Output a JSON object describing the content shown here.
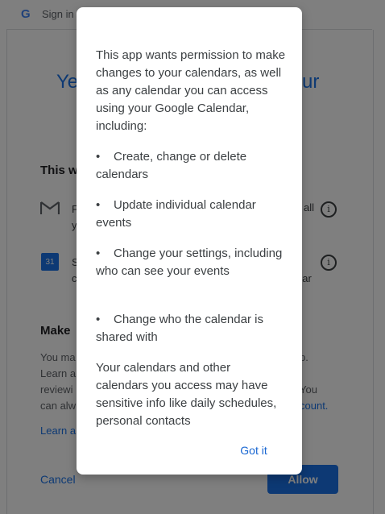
{
  "background": {
    "topbar": {
      "logo": "G",
      "title": "Sign in"
    },
    "title_left": "Ye",
    "title_right": "ur",
    "section_heading": "This w",
    "rows": [
      {
        "icon": "gmail-icon",
        "left": "F\ny",
        "right": "all"
      },
      {
        "icon": "calendar-icon",
        "left": "S\nc",
        "right": "e\ndar",
        "icon_text": "31"
      }
    ],
    "make_heading": "Make",
    "paragraph_left": "You ma\nLearn a\nreviewi\ncan alw",
    "paragraph_right_lines": [
      "p.",
      "",
      "You",
      "count."
    ],
    "learn_link": "Learn a",
    "cancel_label": "Cancel",
    "allow_label": "Allow"
  },
  "dialog": {
    "intro": "This app wants permission to make changes to your calendars, as well as any calendar you can access using your Google Calendar, including:",
    "bullets": [
      "Create, change or delete calendars",
      "Update individual calendar events",
      "Change your settings, including who can see your events",
      "Change who the calendar is shared with"
    ],
    "outro": "Your calendars and other calendars you access may have sensitive info like daily schedules, personal contacts",
    "got_it_label": "Got it"
  },
  "colors": {
    "accent": "#1a73e8",
    "dialog_bg": "#ffffff",
    "scrim": "rgba(0,0,0,0.5)"
  }
}
